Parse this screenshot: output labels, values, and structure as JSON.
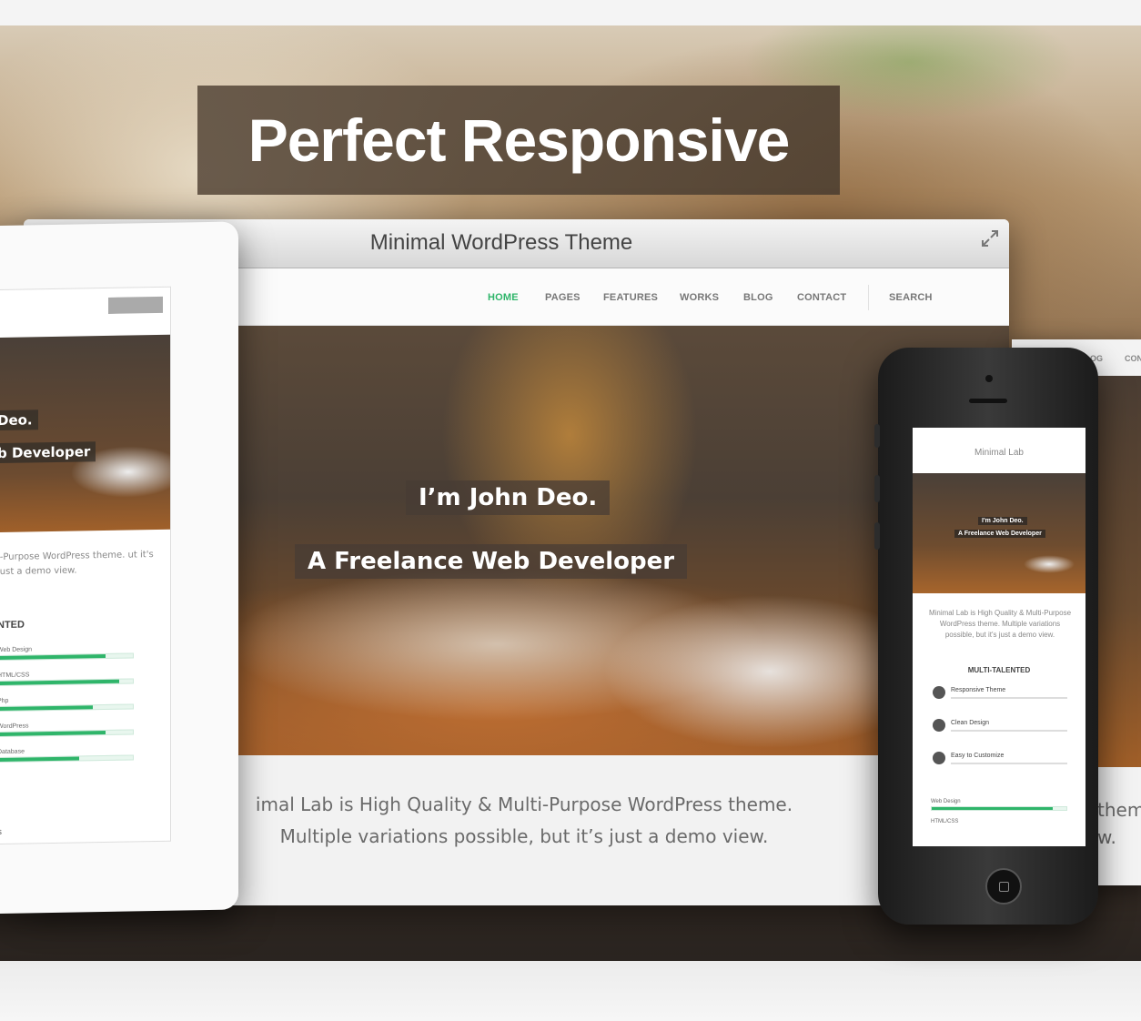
{
  "banner": {
    "title": "Perfect Responsive"
  },
  "window": {
    "title": "Minimal WordPress Theme",
    "nav": [
      {
        "label": "HOME",
        "active": true
      },
      {
        "label": "PAGES"
      },
      {
        "label": "FEATURES"
      },
      {
        "label": "WORKS"
      },
      {
        "label": "BLOG"
      },
      {
        "label": "CONTACT"
      },
      {
        "label": "SEARCH"
      }
    ],
    "hero": {
      "line1": "I’m John Deo.",
      "line2": "A Freelance Web Developer"
    },
    "intro": {
      "line1": "imal Lab is High Quality & Multi-Purpose WordPress theme.",
      "line2": "Multiple variations possible, but it’s just a demo view."
    }
  },
  "tablet": {
    "hero1": "Deo.",
    "hero2": "b Developer",
    "intro": "i-Purpose WordPress theme. ut it's just a demo view.",
    "heading": "NTED",
    "skills": [
      {
        "label": "Web Design",
        "level": 0.8
      },
      {
        "label": "HTML/CSS",
        "level": 0.9
      },
      {
        "label": "Php",
        "level": 0.7
      },
      {
        "label": "WordPress",
        "level": 0.8
      },
      {
        "label": "Database",
        "level": 0.6
      }
    ]
  },
  "monitor2": {
    "nav1": "OG",
    "nav2": "CON",
    "text1": "them",
    "text2": "w."
  },
  "phone": {
    "site_title": "Minimal Lab",
    "hero1": "I'm John Deo.",
    "hero2": "A Freelance Web Developer",
    "intro": "Minimal Lab is High Quality & Multi-Purpose WordPress theme. Multiple variations possible, but it's just a demo view.",
    "heading": "MULTI-TALENTED",
    "features": [
      "Responsive Theme",
      "Clean Design",
      "Easy to Customize"
    ],
    "skill1": {
      "label": "Web Design",
      "level": 0.9
    },
    "skill2": "HTML/CSS"
  },
  "colors": {
    "accent": "#2fb56a"
  }
}
